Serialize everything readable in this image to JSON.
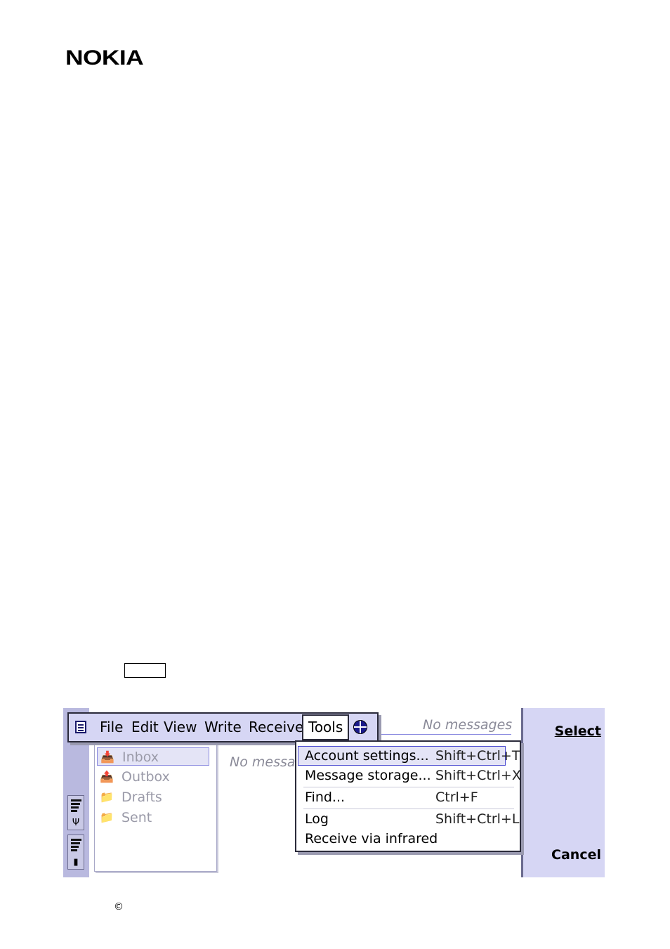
{
  "header": {
    "logo_text": "NOKIA"
  },
  "footer": {
    "copyright_symbol": "©"
  },
  "menubar": {
    "items": [
      {
        "label": "File"
      },
      {
        "label": "Edit"
      },
      {
        "label": "View"
      },
      {
        "label": "Write"
      },
      {
        "label": "Receive"
      },
      {
        "label": "Tools",
        "active": true
      }
    ],
    "left_icon": "document-icon",
    "right_icon": "globe-icon"
  },
  "tools_menu": {
    "items": [
      {
        "label": "Account settings...",
        "shortcut": "Shift+Ctrl+T",
        "highlighted": true
      },
      {
        "label": "Message storage...",
        "shortcut": "Shift+Ctrl+X"
      },
      {
        "label": "Find...",
        "shortcut": "Ctrl+F"
      },
      {
        "label": "Log",
        "shortcut": "Shift+Ctrl+L"
      },
      {
        "label": "Receive via infrared",
        "shortcut": ""
      }
    ]
  },
  "folders": {
    "items": [
      {
        "label": "Inbox",
        "icon": "inbox-tray-icon",
        "selected": true
      },
      {
        "label": "Outbox",
        "icon": "outbox-tray-icon"
      },
      {
        "label": "Drafts",
        "icon": "folder-icon"
      },
      {
        "label": "Sent",
        "icon": "folder-icon"
      }
    ]
  },
  "message_list": {
    "status_header": "No messages",
    "empty_text": "No messag"
  },
  "command_buttons": {
    "select": "Select",
    "cancel": "Cancel"
  },
  "indicators": {
    "signal_icon": "antenna-icon",
    "battery_icon": "battery-icon"
  },
  "colors": {
    "panel_background": "#d6d6f4",
    "strip_background": "#b9b9df",
    "highlight_border": "#4a4ad0",
    "disabled_text": "#9a9aa8"
  }
}
